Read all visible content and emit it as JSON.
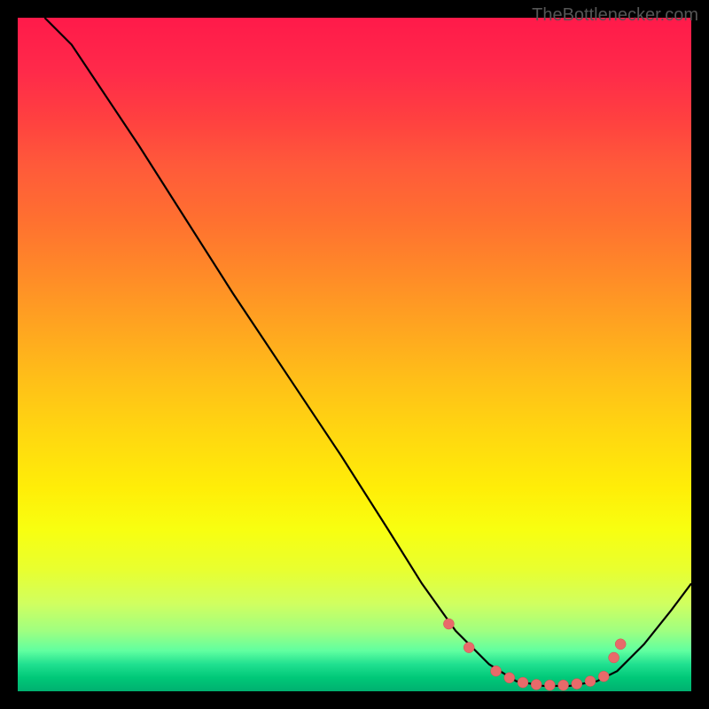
{
  "watermark": "TheBottlenecker.com",
  "chart_data": {
    "type": "line",
    "title": "",
    "xlabel": "",
    "ylabel": "",
    "xlim": [
      0,
      100
    ],
    "ylim": [
      0,
      100
    ],
    "curve": [
      {
        "x": 4,
        "y": 100
      },
      {
        "x": 8,
        "y": 96
      },
      {
        "x": 12,
        "y": 90
      },
      {
        "x": 18,
        "y": 81
      },
      {
        "x": 25,
        "y": 70
      },
      {
        "x": 32,
        "y": 59
      },
      {
        "x": 40,
        "y": 47
      },
      {
        "x": 48,
        "y": 35
      },
      {
        "x": 55,
        "y": 24
      },
      {
        "x": 60,
        "y": 16
      },
      {
        "x": 65,
        "y": 9
      },
      {
        "x": 70,
        "y": 4
      },
      {
        "x": 74,
        "y": 1.5
      },
      {
        "x": 78,
        "y": 0.8
      },
      {
        "x": 82,
        "y": 0.8
      },
      {
        "x": 86,
        "y": 1.5
      },
      {
        "x": 89,
        "y": 3
      },
      {
        "x": 93,
        "y": 7
      },
      {
        "x": 97,
        "y": 12
      },
      {
        "x": 100,
        "y": 16
      }
    ],
    "markers": [
      {
        "x": 64,
        "y": 10
      },
      {
        "x": 67,
        "y": 6.5
      },
      {
        "x": 71,
        "y": 3
      },
      {
        "x": 73,
        "y": 2
      },
      {
        "x": 75,
        "y": 1.3
      },
      {
        "x": 77,
        "y": 1
      },
      {
        "x": 79,
        "y": 0.9
      },
      {
        "x": 81,
        "y": 0.9
      },
      {
        "x": 83,
        "y": 1.1
      },
      {
        "x": 85,
        "y": 1.5
      },
      {
        "x": 87,
        "y": 2.2
      },
      {
        "x": 88.5,
        "y": 5
      },
      {
        "x": 89.5,
        "y": 7
      }
    ],
    "gradient_stops": [
      {
        "pos": 0,
        "color": "#ff1a4a"
      },
      {
        "pos": 50,
        "color": "#ffc018"
      },
      {
        "pos": 80,
        "color": "#f0ff20"
      },
      {
        "pos": 100,
        "color": "#00b070"
      }
    ]
  }
}
